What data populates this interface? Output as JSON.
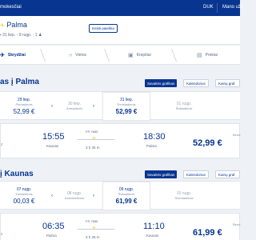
{
  "topbar": {
    "crumb": "mokesčiai",
    "currency": "DUK",
    "account": "Mano užs"
  },
  "summary": {
    "route_to": "Palma",
    "dates": "31 liep. - 9 rugp.",
    "passengers": "1",
    "edit_label": "Keisti paieška"
  },
  "steps": [
    {
      "label": "Skrydžiai",
      "icon": "plane-icon"
    },
    {
      "label": "Vietos",
      "icon": "seat-icon"
    },
    {
      "label": "Krepšiai",
      "icon": "bag-icon"
    },
    {
      "label": "Prekiai",
      "icon": "car-icon"
    }
  ],
  "toolbar": {
    "prices_chart": "Savaitės grafikas",
    "calendar": "Kalendorius",
    "price_chart": "Kainų graf"
  },
  "outbound": {
    "title": "as į Palma",
    "dates": [
      {
        "day": "29 liep.",
        "weekday": "Pirmadienis",
        "price": "52,99 €"
      },
      {
        "day": "30 liep.",
        "weekday": "Antradienis",
        "price": ""
      },
      {
        "day": "31 liep.",
        "weekday": "Penktadienis",
        "price": "52,99 €"
      },
      {
        "day": "01 rugp.",
        "weekday": "Šeštadienis",
        "price": ""
      }
    ],
    "flight": {
      "left_text": "z",
      "dep_time": "15:55",
      "dep_city": "Kaunas",
      "number": "FR 7885",
      "duration": "3 h 35 m",
      "arr_time": "18:30",
      "arr_city": "Palma",
      "price_label": "Bend",
      "price": "52,99 €"
    }
  },
  "inbound": {
    "title": "į Kaunas",
    "dates": [
      {
        "day": "07 rugp.",
        "weekday": "Trečiadienis",
        "price": "00,03 €"
      },
      {
        "day": "08 rugp.",
        "weekday": "Ketvirtadienis",
        "price": ""
      },
      {
        "day": "09 rugp.",
        "weekday": "Šeštadienis",
        "price": "61,99 €"
      },
      {
        "day": "10 rugp.",
        "weekday": "Sekmadienis",
        "price": ""
      }
    ],
    "flight": {
      "left_text": "z",
      "dep_time": "06:35",
      "dep_city": "Palma",
      "number": "FR 7886",
      "duration": "3 h 35 m",
      "arr_time": "11:10",
      "arr_city": "Kaunas",
      "price_label": "Bend",
      "price": "61,99 €"
    }
  },
  "colors": {
    "brand": "#073590",
    "accent": "#f1c933"
  }
}
